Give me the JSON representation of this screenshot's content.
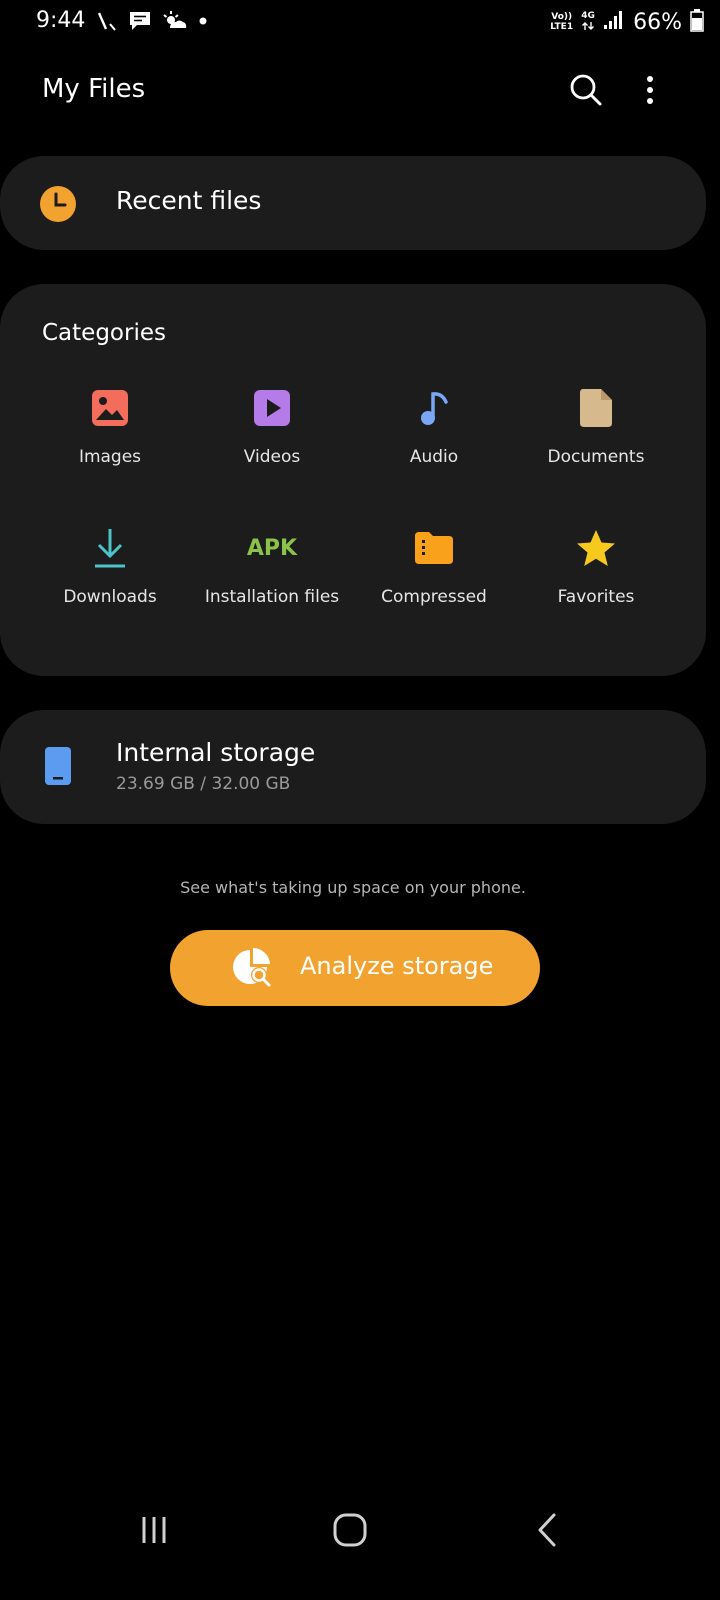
{
  "status_bar": {
    "time": "9:44",
    "volte_top": "Vo))",
    "volte_bottom": "LTE1",
    "network_type": "4G",
    "battery_percent": "66%"
  },
  "header": {
    "title": "My Files",
    "icons": [
      "search-icon",
      "more-options-icon"
    ]
  },
  "recent": {
    "label": "Recent files",
    "icon": "clock-icon"
  },
  "categories": {
    "title": "Categories",
    "items": [
      {
        "label": "Images",
        "icon": "image-icon",
        "color": "#f26d5b"
      },
      {
        "label": "Videos",
        "icon": "video-icon",
        "color": "#b57be8"
      },
      {
        "label": "Audio",
        "icon": "music-note-icon",
        "color": "#7aa7f5"
      },
      {
        "label": "Documents",
        "icon": "document-icon",
        "color": "#d6b98c"
      },
      {
        "label": "Downloads",
        "icon": "download-icon",
        "color": "#4cc3c9"
      },
      {
        "label": "Installation files",
        "icon": "apk-icon",
        "icon_text": "APK",
        "color": "#8bc34a"
      },
      {
        "label": "Compressed",
        "icon": "compressed-folder-icon",
        "color": "#f9a11b"
      },
      {
        "label": "Favorites",
        "icon": "star-icon",
        "color": "#f7c91c"
      }
    ]
  },
  "storage": {
    "title": "Internal storage",
    "usage": "23.69 GB / 32.00 GB",
    "icon": "phone-storage-icon",
    "color": "#5b9cf0"
  },
  "analyze": {
    "hint": "See what's taking up space on your phone.",
    "button_label": "Analyze storage",
    "button_color": "#f2a22e",
    "icon": "analyze-storage-icon"
  },
  "nav_bar": {
    "icons": [
      "recent-apps-icon",
      "home-icon",
      "back-icon"
    ]
  }
}
